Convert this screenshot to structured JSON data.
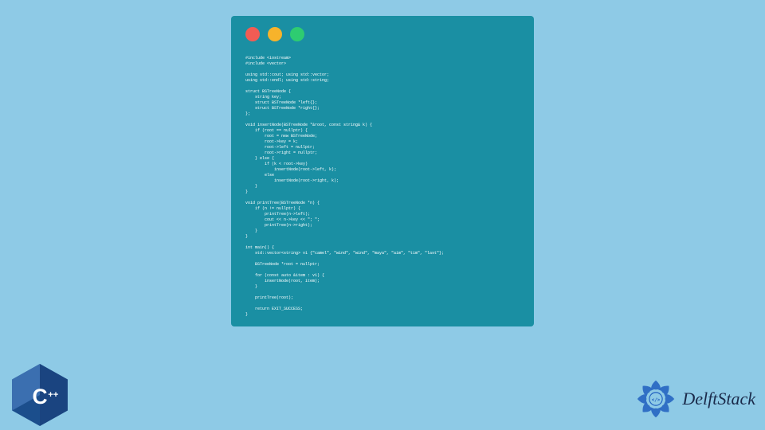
{
  "window_controls": {
    "red": "close",
    "yellow": "minimize",
    "green": "maximize"
  },
  "code": "#include <iostream>\n#include <vector>\n\nusing std::cout; using std::vector;\nusing std::endl; using std::string;\n\nstruct BSTreeNode {\n    string key;\n    struct BSTreeNode *left{};\n    struct BSTreeNode *right{};\n};\n\nvoid insertNode(BSTreeNode *&root, const string& k) {\n    if (root == nullptr) {\n        root = new BSTreeNode;\n        root->key = k;\n        root->left = nullptr;\n        root->right = nullptr;\n    } else {\n        if (k < root->key)\n            insertNode(root->left, k);\n        else\n            insertNode(root->right, k);\n    }\n}\n\nvoid printTree(BSTreeNode *n) {\n    if (n != nullptr) {\n        printTree(n->left);\n        cout << n->key << \"; \";\n        printTree(n->right);\n    }\n}\n\nint main() {\n    std::vector<string> v1 {\"camel\", \"wind\", \"wind\", \"maya\", \"aim\", \"tim\", \"last\"};\n\n    BSTreeNode *root = nullptr;\n\n    for (const auto &item : v1) {\n        insertNode(root, item);\n    }\n\n    printTree(root);\n\n    return EXIT_SUCCESS;\n}",
  "cpp_logo": {
    "label": "C++",
    "color_dark": "#1b4e8c",
    "color_light": "#5a9bd5"
  },
  "delft_logo": {
    "text": "DelftStack",
    "emblem_color": "#2060c0"
  }
}
